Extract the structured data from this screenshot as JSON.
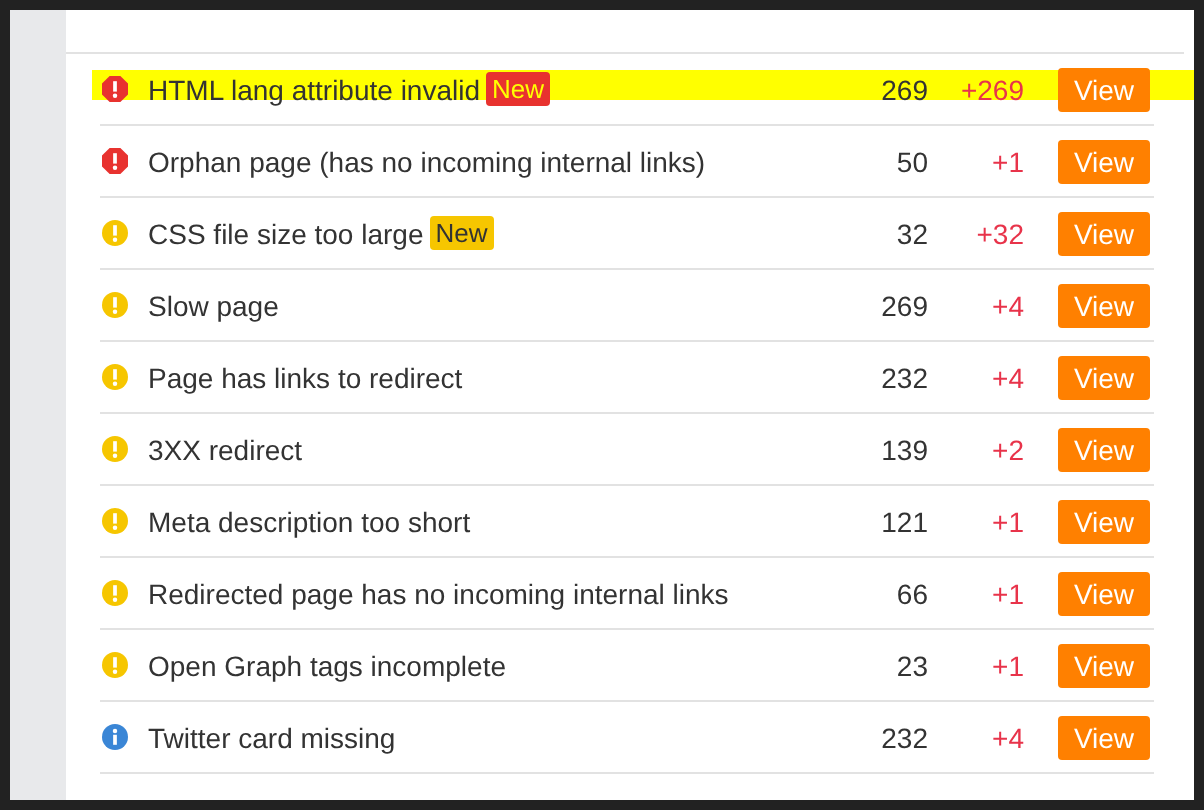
{
  "issues": [
    {
      "kind": "error",
      "title": "HTML lang attribute invalid",
      "badge": {
        "label": "New",
        "kind": "error"
      },
      "highlighted": true,
      "count": "269",
      "change": "+269",
      "action": "View"
    },
    {
      "kind": "error",
      "title": "Orphan page (has no incoming internal links)",
      "highlighted": false,
      "count": "50",
      "change": "+1",
      "action": "View"
    },
    {
      "kind": "warning",
      "title": "CSS file size too large",
      "badge": {
        "label": "New",
        "kind": "warning"
      },
      "highlighted": false,
      "count": "32",
      "change": "+32",
      "action": "View"
    },
    {
      "kind": "warning",
      "title": "Slow page",
      "highlighted": false,
      "count": "269",
      "change": "+4",
      "action": "View"
    },
    {
      "kind": "warning",
      "title": "Page has links to redirect",
      "highlighted": false,
      "count": "232",
      "change": "+4",
      "action": "View"
    },
    {
      "kind": "warning",
      "title": "3XX redirect",
      "highlighted": false,
      "count": "139",
      "change": "+2",
      "action": "View"
    },
    {
      "kind": "warning",
      "title": "Meta description too short",
      "highlighted": false,
      "count": "121",
      "change": "+1",
      "action": "View"
    },
    {
      "kind": "warning",
      "title": "Redirected page has no incoming internal links",
      "highlighted": false,
      "count": "66",
      "change": "+1",
      "action": "View"
    },
    {
      "kind": "warning",
      "title": "Open Graph tags incomplete",
      "highlighted": false,
      "count": "23",
      "change": "+1",
      "action": "View"
    },
    {
      "kind": "notice",
      "title": "Twitter card missing",
      "highlighted": false,
      "count": "232",
      "change": "+4",
      "action": "View"
    }
  ]
}
